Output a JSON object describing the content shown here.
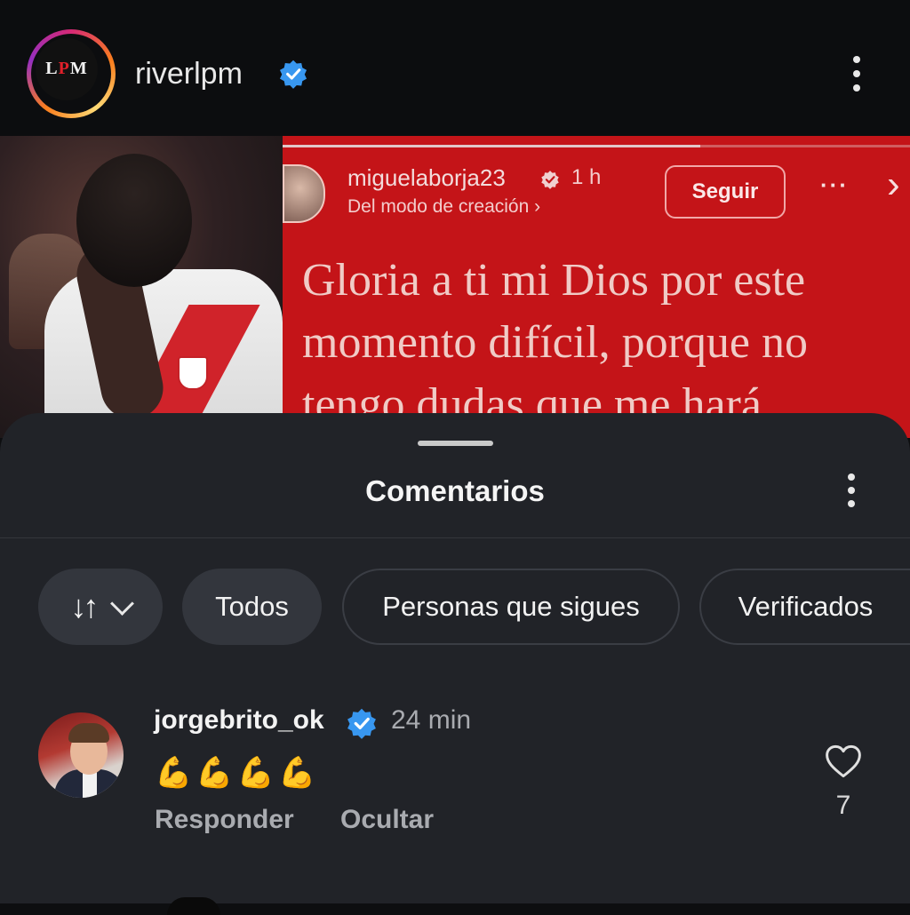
{
  "header": {
    "account_name": "riverlpm",
    "logo_text_left": "L",
    "logo_text_mid": "P",
    "logo_text_right": "M"
  },
  "post": {
    "story": {
      "username": "miguelaborja23",
      "time": "1 h",
      "subtitle": "Del modo de creación ›",
      "follow_label": "Seguir",
      "more_label": "···",
      "close_label": "›",
      "text_lines": [
        "Gloria a ti mi Dios por este",
        "momento difícil, porque no",
        "tengo dudas que me hará"
      ],
      "background_color": "#c41418"
    }
  },
  "comments_sheet": {
    "title": "Comentarios",
    "filters": {
      "sort_icon": "↓↑",
      "all": "Todos",
      "following": "Personas que sigues",
      "verified": "Verificados"
    },
    "comment": {
      "username": "jorgebrito_ok",
      "time": "24 min",
      "text": "💪💪💪💪",
      "reply_label": "Responder",
      "hide_label": "Ocultar",
      "likes": "7"
    }
  },
  "colors": {
    "verified_blue": "#3897f0",
    "sheet_bg": "#212328",
    "chip_bg": "#33363d"
  }
}
